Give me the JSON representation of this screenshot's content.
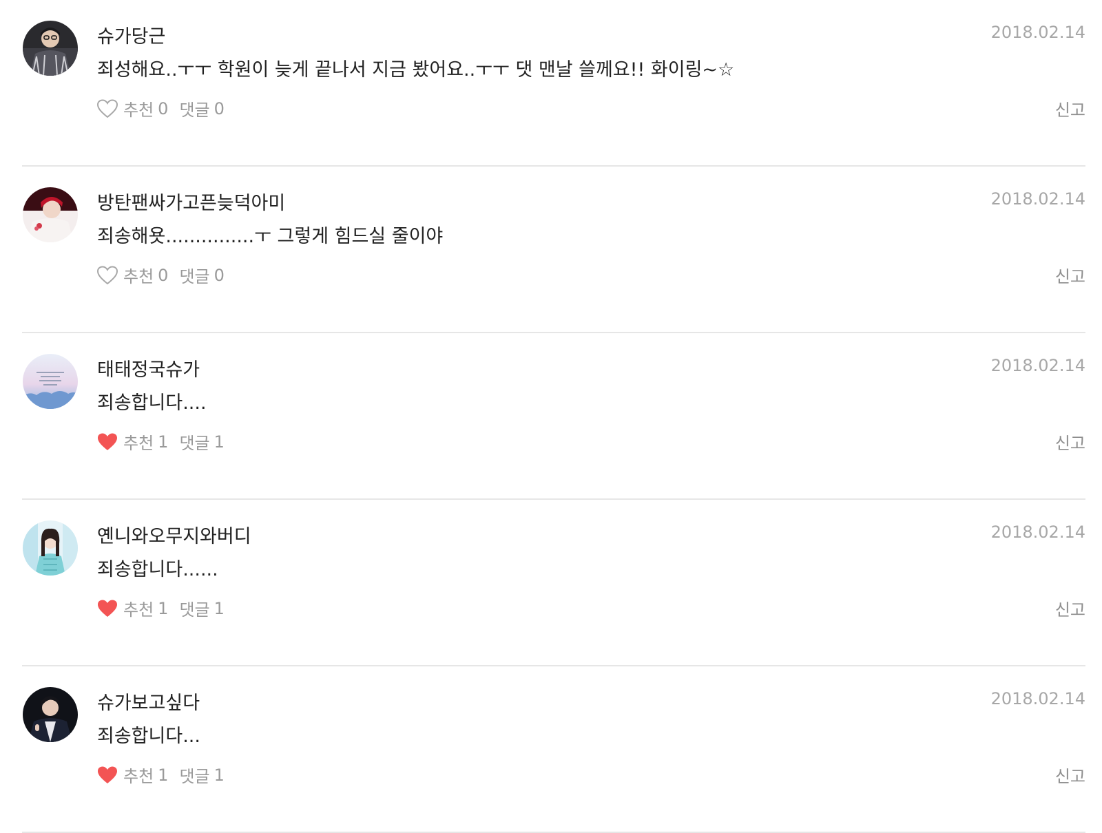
{
  "colors": {
    "heart_liked": "#f35454",
    "heart_outline": "#a8a8a8",
    "divider": "#e6e6e6",
    "meta_text": "#9a9a9a"
  },
  "labels": {
    "like": "추천",
    "reply": "댓글",
    "report": "신고"
  },
  "comments": [
    {
      "username": "슈가당근",
      "date": "2018.02.14",
      "text": "죄성해요..ㅜㅜ 학원이 늦게 끝나서 지금 봤어요..ㅜㅜ 댓 맨날 쓸께요!! 화이링~☆",
      "likes": "0",
      "replies": "0",
      "liked": false,
      "avatar_icon": "profile-photo"
    },
    {
      "username": "방탄팬싸가고픈늦덕아미",
      "date": "2018.02.14",
      "text": "죄송해욧...............ㅜ 그렇게 힘드실 줄이야",
      "likes": "0",
      "replies": "0",
      "liked": false,
      "avatar_icon": "profile-photo"
    },
    {
      "username": "태태정국슈가",
      "date": "2018.02.14",
      "text": "죄송합니다....",
      "likes": "1",
      "replies": "1",
      "liked": true,
      "avatar_icon": "profile-photo"
    },
    {
      "username": "옌니와오무지와버디",
      "date": "2018.02.14",
      "text": "죄송합니다......",
      "likes": "1",
      "replies": "1",
      "liked": true,
      "avatar_icon": "profile-photo"
    },
    {
      "username": "슈가보고싶다",
      "date": "2018.02.14",
      "text": "죄송합니다...",
      "likes": "1",
      "replies": "1",
      "liked": true,
      "avatar_icon": "profile-photo"
    }
  ]
}
